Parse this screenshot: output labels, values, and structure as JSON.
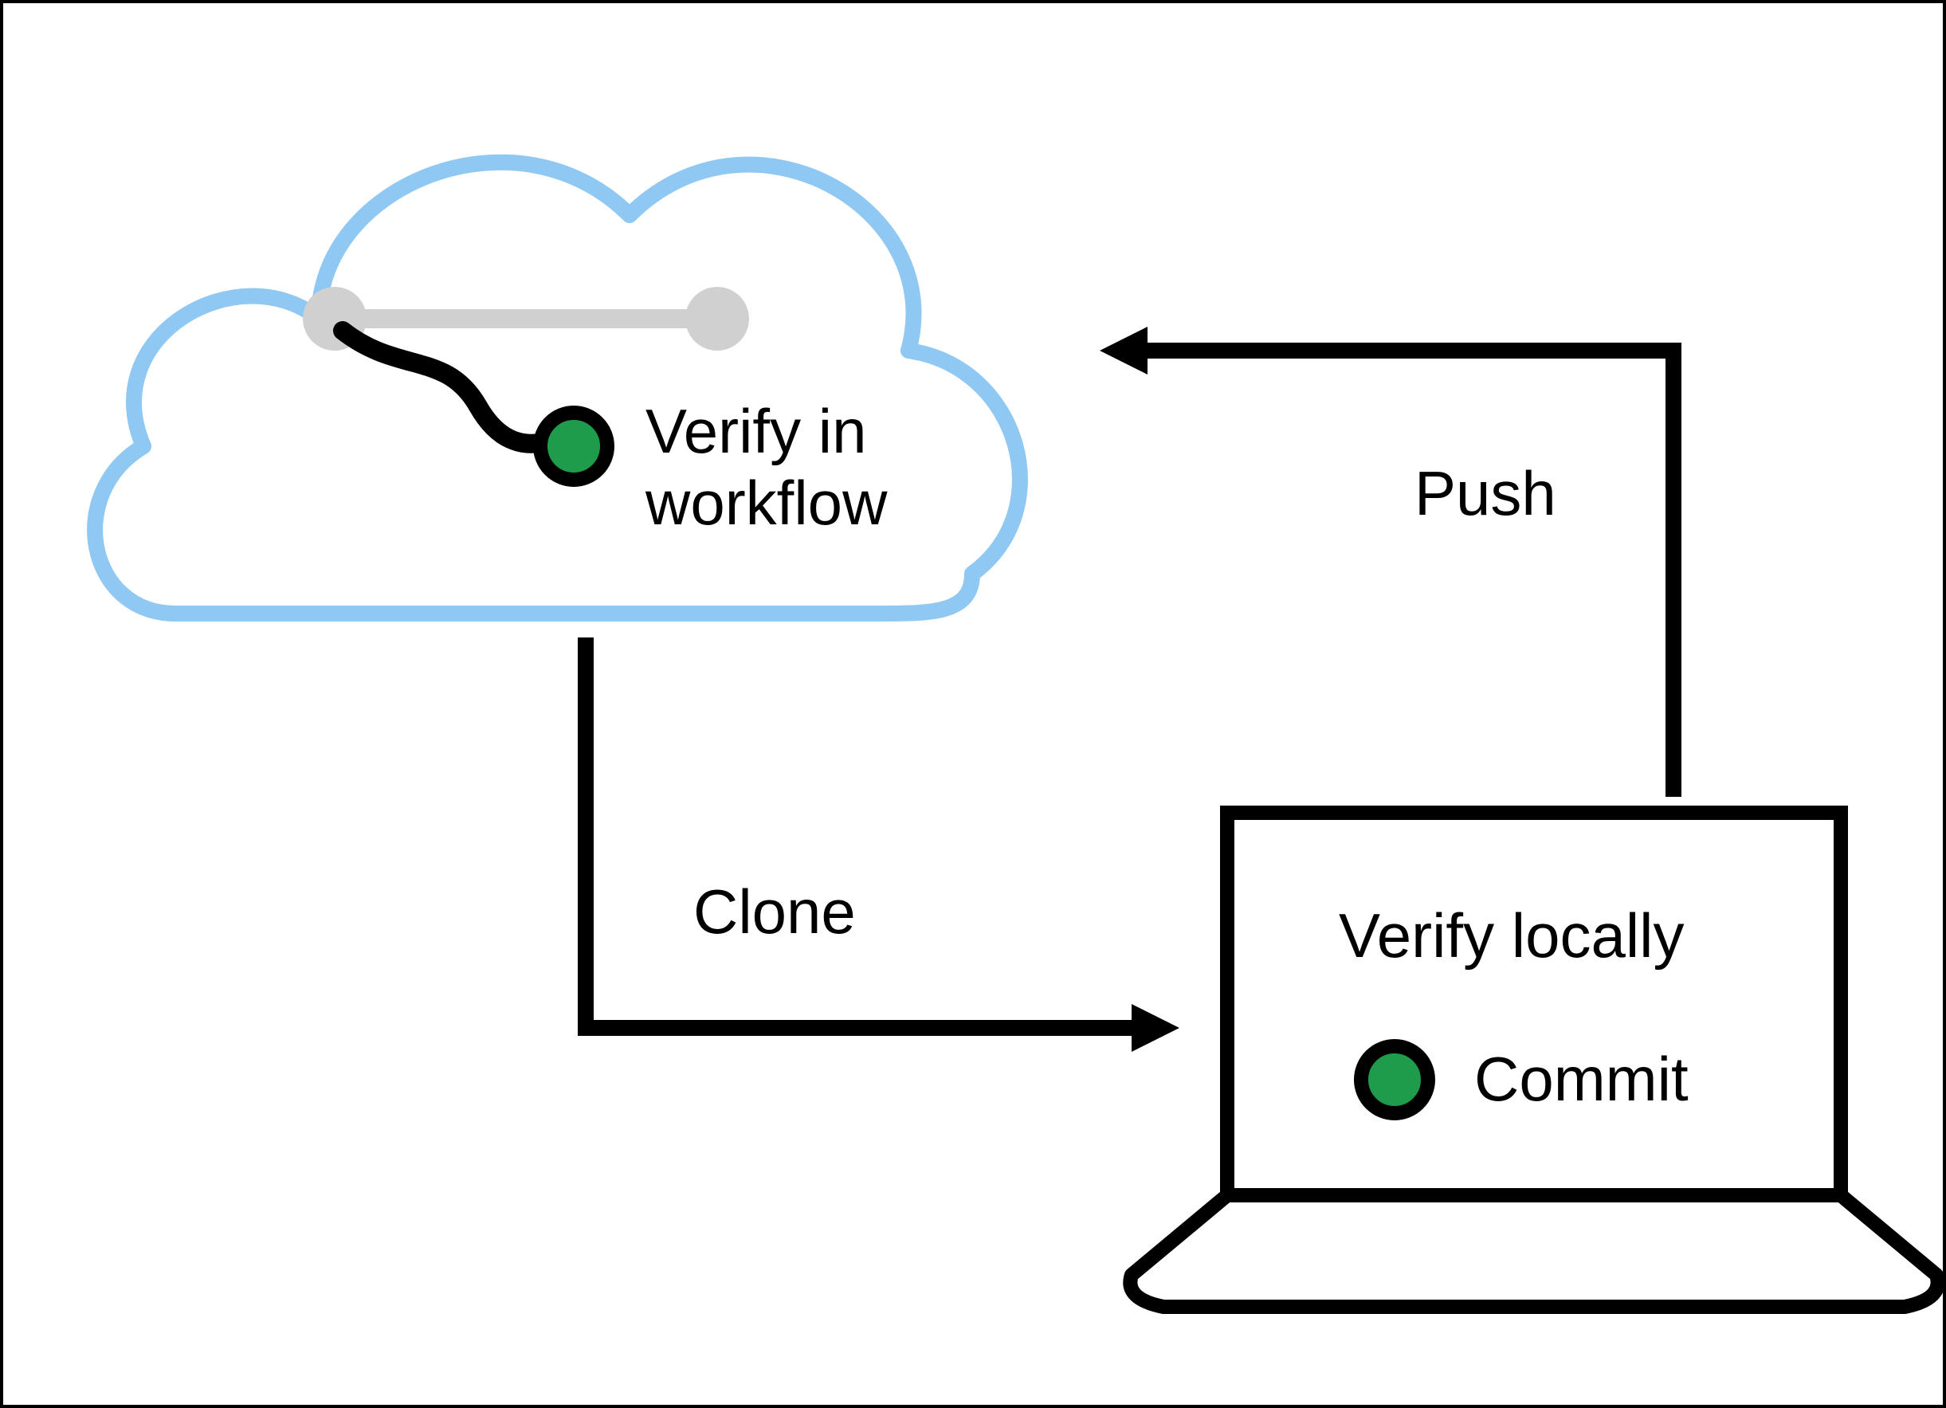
{
  "diagram": {
    "cloud_label_line1": "Verify in",
    "cloud_label_line2": "workflow",
    "clone_label": "Clone",
    "push_label": "Push",
    "laptop_label_top": "Verify locally",
    "laptop_commit_label": "Commit",
    "colors": {
      "cloud_stroke": "#8FC8F2",
      "branch_gray": "#D0D0D0",
      "dot_green": "#1E9C4B",
      "black": "#000000"
    }
  }
}
